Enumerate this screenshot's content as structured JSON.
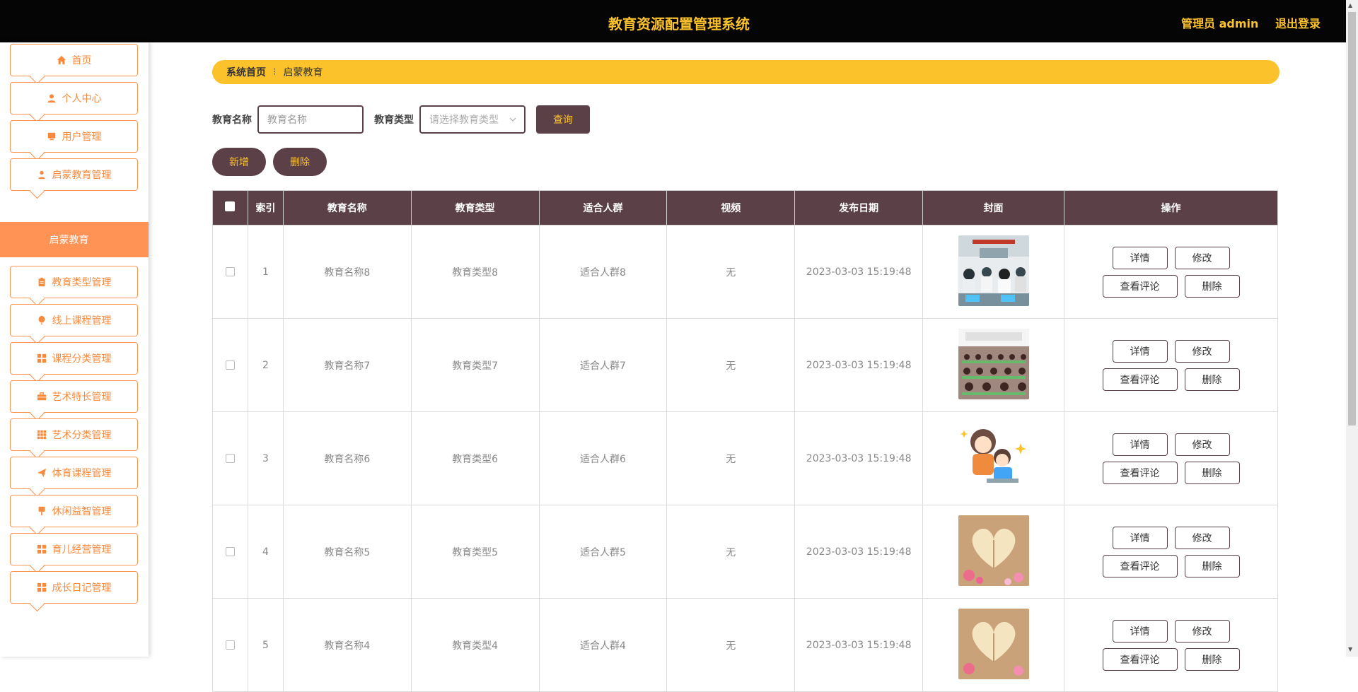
{
  "header": {
    "title": "教育资源配置管理系统",
    "user": "管理员 admin",
    "logout": "退出登录"
  },
  "sidebar": {
    "items": [
      {
        "label": "首页",
        "icon": "home-icon"
      },
      {
        "label": "个人中心",
        "icon": "user-icon"
      },
      {
        "label": "用户管理",
        "icon": "monitor-icon"
      },
      {
        "label": "启蒙教育管理",
        "icon": "person-icon"
      },
      {
        "label": "教育类型管理",
        "icon": "clipboard-icon"
      },
      {
        "label": "线上课程管理",
        "icon": "balloon-icon"
      },
      {
        "label": "课程分类管理",
        "icon": "grid-icon"
      },
      {
        "label": "艺术特长管理",
        "icon": "briefcase-icon"
      },
      {
        "label": "艺术分类管理",
        "icon": "grid9-icon"
      },
      {
        "label": "体育课程管理",
        "icon": "send-icon"
      },
      {
        "label": "休闲益智管理",
        "icon": "pin-icon"
      },
      {
        "label": "育儿经营管理",
        "icon": "grid-icon"
      },
      {
        "label": "成长日记管理",
        "icon": "grid-icon"
      }
    ],
    "active": "启蒙教育"
  },
  "breadcrumb": {
    "home": "系统首页",
    "current": "启蒙教育"
  },
  "search": {
    "name_label": "教育名称",
    "name_placeholder": "教育名称",
    "type_label": "教育类型",
    "type_placeholder": "请选择教育类型",
    "query": "查询"
  },
  "actions": {
    "add": "新增",
    "delete": "删除"
  },
  "table": {
    "columns": [
      "索引",
      "教育名称",
      "教育类型",
      "适合人群",
      "视频",
      "发布日期",
      "封面",
      "操作"
    ],
    "rows": [
      {
        "index": "1",
        "name": "教育名称8",
        "type": "教育类型8",
        "crowd": "适合人群8",
        "video": "无",
        "date": "2023-03-03 15:19:48",
        "cover": "classroom-photo"
      },
      {
        "index": "2",
        "name": "教育名称7",
        "type": "教育类型7",
        "crowd": "适合人群7",
        "video": "无",
        "date": "2023-03-03 15:19:48",
        "cover": "classroom-photo"
      },
      {
        "index": "3",
        "name": "教育名称6",
        "type": "教育类型6",
        "crowd": "适合人群6",
        "video": "无",
        "date": "2023-03-03 15:19:48",
        "cover": "cartoon-mother-child"
      },
      {
        "index": "4",
        "name": "教育名称5",
        "type": "教育类型5",
        "crowd": "适合人群5",
        "video": "无",
        "date": "2023-03-03 15:19:48",
        "cover": "book-heart-photo"
      },
      {
        "index": "5",
        "name": "教育名称4",
        "type": "教育类型4",
        "crowd": "适合人群4",
        "video": "无",
        "date": "2023-03-03 15:19:48",
        "cover": "book-heart-photo"
      }
    ],
    "ops": {
      "detail": "详情",
      "edit": "修改",
      "comments": "查看评论",
      "delete": "删除"
    }
  },
  "colors": {
    "header_bg": "#050505",
    "accent": "#fcc22c",
    "brown": "#5b4048",
    "orange": "#ff9255"
  }
}
